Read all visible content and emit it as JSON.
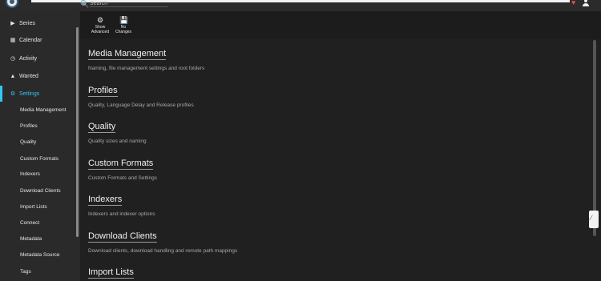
{
  "header": {
    "search_placeholder": "Search",
    "brand_color": "#35c5f4"
  },
  "sidebar": {
    "items": [
      {
        "label": "Series",
        "icon": "play-icon"
      },
      {
        "label": "Calendar",
        "icon": "calendar-icon"
      },
      {
        "label": "Activity",
        "icon": "clock-icon"
      },
      {
        "label": "Wanted",
        "icon": "warning-icon"
      },
      {
        "label": "Settings",
        "icon": "gears-icon",
        "active": true
      }
    ],
    "settings_children": [
      "Media Management",
      "Profiles",
      "Quality",
      "Custom Formats",
      "Indexers",
      "Download Clients",
      "Import Lists",
      "Connect",
      "Metadata",
      "Metadata Source",
      "Tags"
    ]
  },
  "toolbar": {
    "show_advanced_label": "Show\nAdvanced",
    "no_changes_label": "No\nChanges"
  },
  "sections": [
    {
      "title": "Media Management",
      "desc": "Naming, file management settings and root folders"
    },
    {
      "title": "Profiles",
      "desc": "Quality, Language Delay and Release profiles"
    },
    {
      "title": "Quality",
      "desc": "Quality sizes and naming"
    },
    {
      "title": "Custom Formats",
      "desc": "Custom Formats and Settings"
    },
    {
      "title": "Indexers",
      "desc": "Indexers and indexer options"
    },
    {
      "title": "Download Clients",
      "desc": "Download clients, download handling and remote path mappings"
    },
    {
      "title": "Import Lists",
      "desc": ""
    }
  ]
}
